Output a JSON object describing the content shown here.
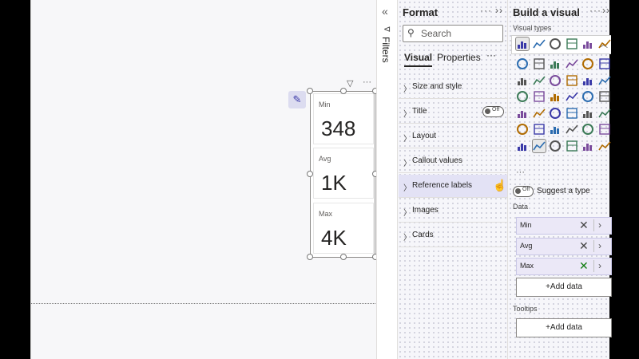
{
  "filters": {
    "label": "Filters",
    "collapse_icon": "double-chevron-left-icon"
  },
  "visual": {
    "cards": [
      {
        "label": "Min",
        "value": "348"
      },
      {
        "label": "Avg",
        "value": "1K"
      },
      {
        "label": "Max",
        "value": "4K"
      }
    ]
  },
  "format_pane": {
    "title": "Format",
    "more": "···",
    "collapse": "››",
    "search_placeholder": "Search",
    "tabs": {
      "visual": "Visual",
      "properties": "Properties",
      "more": "···"
    },
    "sections": [
      {
        "name": "Size and style"
      },
      {
        "name": "Title",
        "toggle": "Off"
      },
      {
        "name": "Layout"
      },
      {
        "name": "Callout values"
      },
      {
        "name": "Reference labels"
      },
      {
        "name": "Images"
      },
      {
        "name": "Cards"
      }
    ]
  },
  "build_pane": {
    "title": "Build a visual",
    "more": "···",
    "collapse": "››",
    "visual_types_label": "Visual types",
    "more_visuals": "···",
    "suggest": {
      "toggle": "Off",
      "label": "Suggest a type"
    },
    "data_label": "Data",
    "fields": [
      {
        "name": "Min"
      },
      {
        "name": "Avg"
      },
      {
        "name": "Max"
      }
    ],
    "add_data": "+Add data",
    "tooltips_label": "Tooltips",
    "tooltips_add": "+Add data"
  },
  "colors": {
    "accent": "#4b4ac0",
    "highlight": "#e3e2f5",
    "field_bg": "#ebe8f7"
  }
}
